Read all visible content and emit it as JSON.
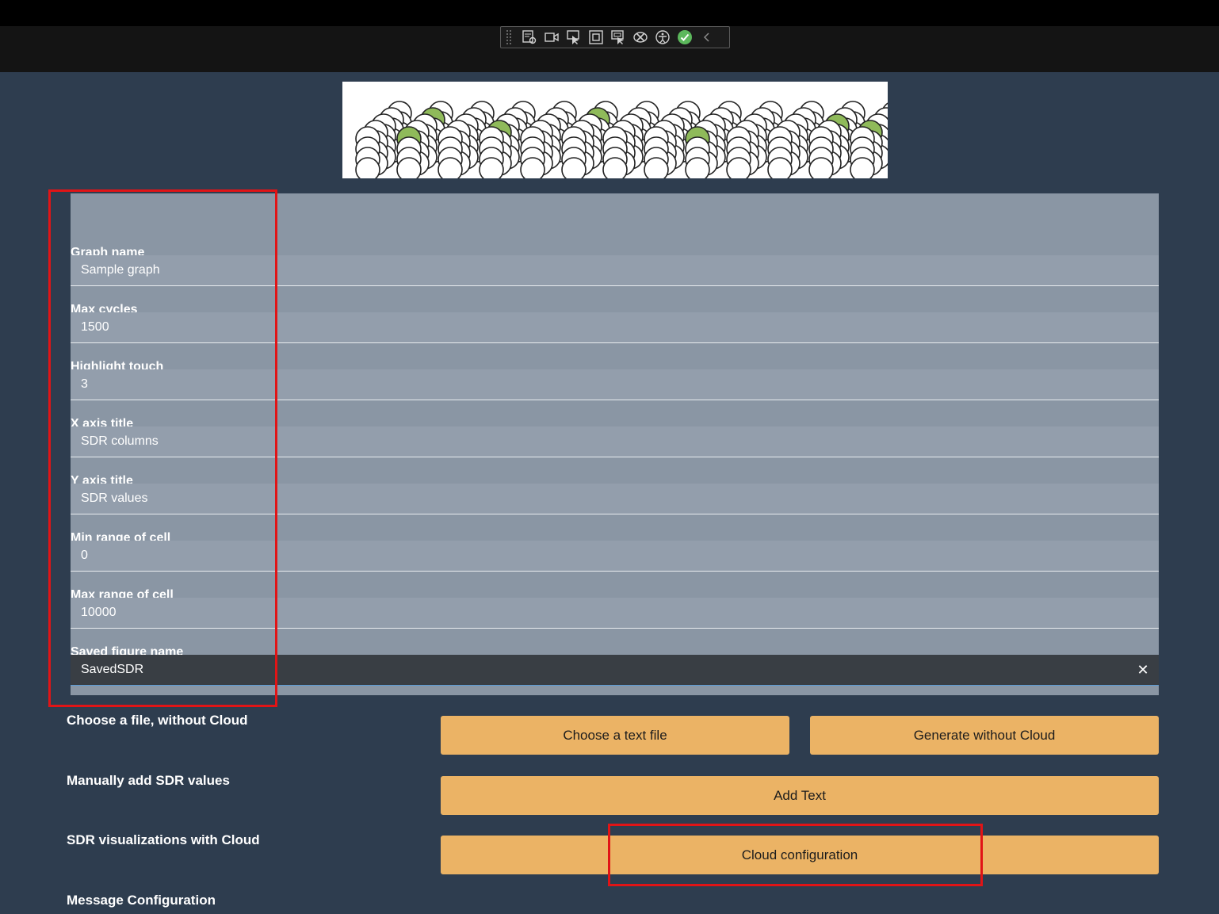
{
  "toolbar": {
    "icons": [
      "live-visual-tree-icon",
      "video-icon",
      "select-element-icon",
      "display-layout-adorners-icon",
      "track-focus-icon",
      "binding-failures-icon",
      "accessibility-icon",
      "check-icon",
      "collapse-chevron-icon"
    ]
  },
  "form": {
    "fields": [
      {
        "label": "Graph name",
        "value": "Sample graph"
      },
      {
        "label": "Max cycles",
        "value": "1500"
      },
      {
        "label": "Highlight touch",
        "value": "3"
      },
      {
        "label": "X axis title",
        "value": "SDR columns"
      },
      {
        "label": "Y axis title",
        "value": "SDR values"
      },
      {
        "label": "Min range of cell",
        "value": "0"
      },
      {
        "label": "Max range of cell",
        "value": "10000"
      },
      {
        "label": "Saved figure name",
        "value": "SavedSDR"
      }
    ],
    "clear_glyph": "✕"
  },
  "actions": {
    "choose_file_label": "Choose a file, without Cloud",
    "choose_text_file": "Choose a text file",
    "generate_without_cloud": "Generate without Cloud",
    "manual_label": "Manually add SDR values",
    "add_text": "Add Text",
    "cloud_label": "SDR visualizations with Cloud",
    "cloud_configuration": "Cloud configuration",
    "message_label": "Message Configuration"
  },
  "colors": {
    "background": "#2e3d4f",
    "panel": "#8a96a4",
    "button": "#ebb365",
    "highlight": "#e11416",
    "cell_active": "#8fba5a"
  }
}
